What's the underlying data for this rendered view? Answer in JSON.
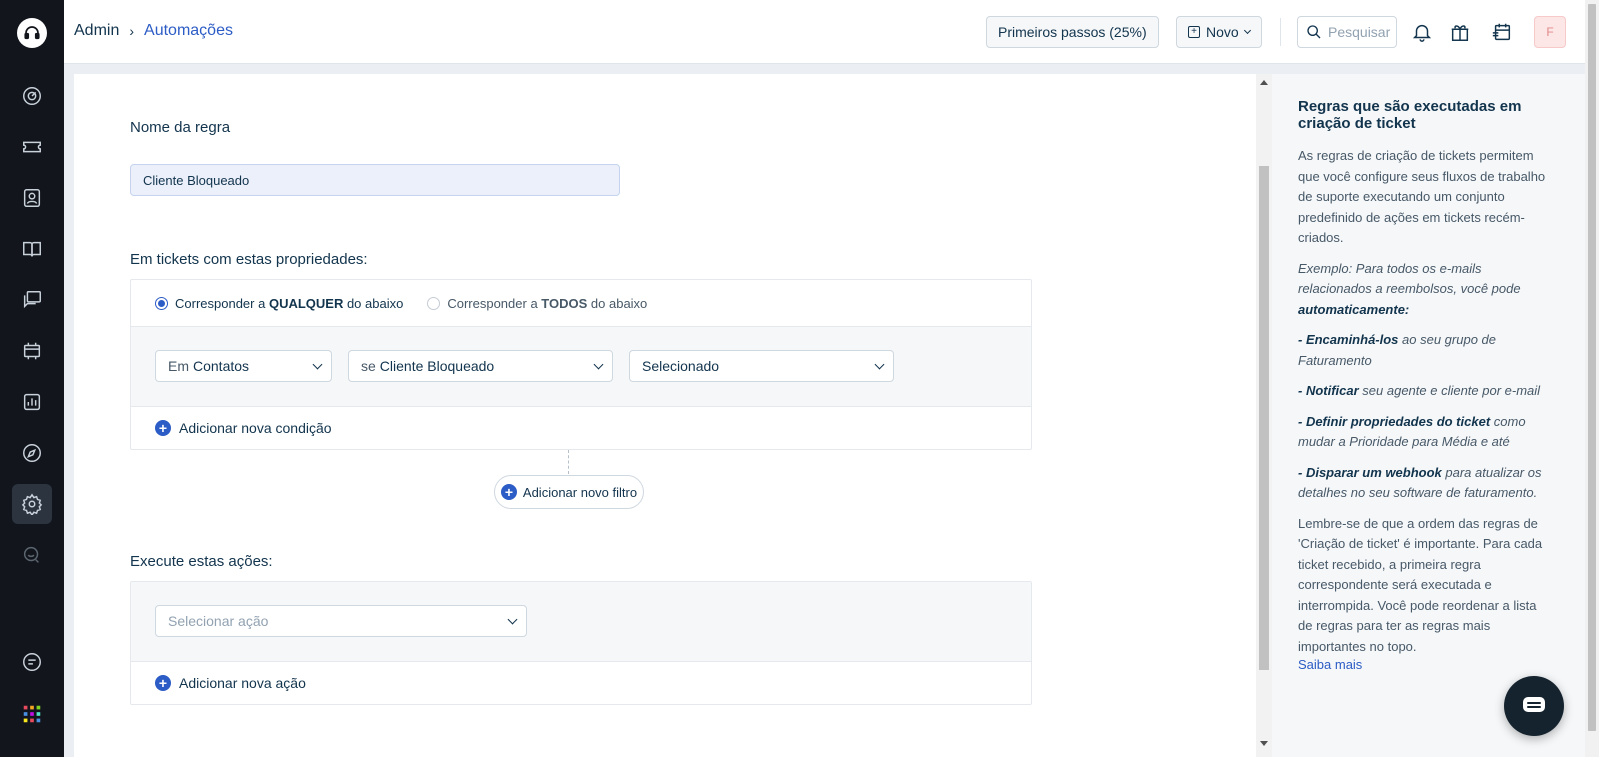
{
  "header": {
    "breadcrumb_root": "Admin",
    "breadcrumb_sep": "›",
    "breadcrumb_current": "Automações",
    "first_steps": "Primeiros passos (25%)",
    "new_button": "Novo",
    "search_placeholder": "Pesquisar",
    "avatar_initial": "F"
  },
  "form": {
    "rule_name_label": "Nome da regra",
    "rule_name_value": "Cliente Bloqueado",
    "conditions_title": "Em tickets com estas propriedades:",
    "match_any_pre": "Corresponder a ",
    "match_any_bold": "QUALQUER",
    "match_any_post": " do abaixo",
    "match_all_pre": "Corresponder a ",
    "match_all_bold": "TODOS",
    "match_all_post": " do abaixo",
    "cond_in_prefix": "Em",
    "cond_in_value": "Contatos",
    "cond_field_prefix": "se",
    "cond_field_value": "Cliente Bloqueado",
    "cond_value": "Selecionado",
    "add_condition": "Adicionar nova condição",
    "add_filter": "Adicionar novo filtro",
    "actions_title": "Execute estas ações:",
    "select_action_placeholder": "Selecionar ação",
    "add_action": "Adicionar nova ação"
  },
  "side": {
    "title": "Regras que são executadas em criação de ticket",
    "intro": "As regras de criação de tickets permitem que você configure seus fluxos de trabalho de suporte executando um conjunto predefinido de ações em tickets recém-criados.",
    "example": "Exemplo: Para todos os e-mails relacionados a reembolsos, você pode ",
    "example_bold": "automaticamente:",
    "item1_bold": "- Encaminhá-los",
    "item1_rest": " ao seu grupo de Faturamento",
    "item2_bold": "- Notificar",
    "item2_rest": " seu agente e cliente por e-mail",
    "item3_bold": "- Definir propriedades do ticket",
    "item3_rest": " como mudar a Prioridade para Média e até",
    "item4_bold": "- Disparar um webhook",
    "item4_rest": " para atualizar os detalhes no seu software de faturamento.",
    "reminder": "Lembre-se de que a ordem das regras de 'Criação de ticket' é importante. Para cada ticket recebido, a primeira regra correspondente será executada e interrompida. Você pode reordenar a lista de regras para ter as regras mais importantes no topo.",
    "learn_more": "Saiba mais"
  }
}
